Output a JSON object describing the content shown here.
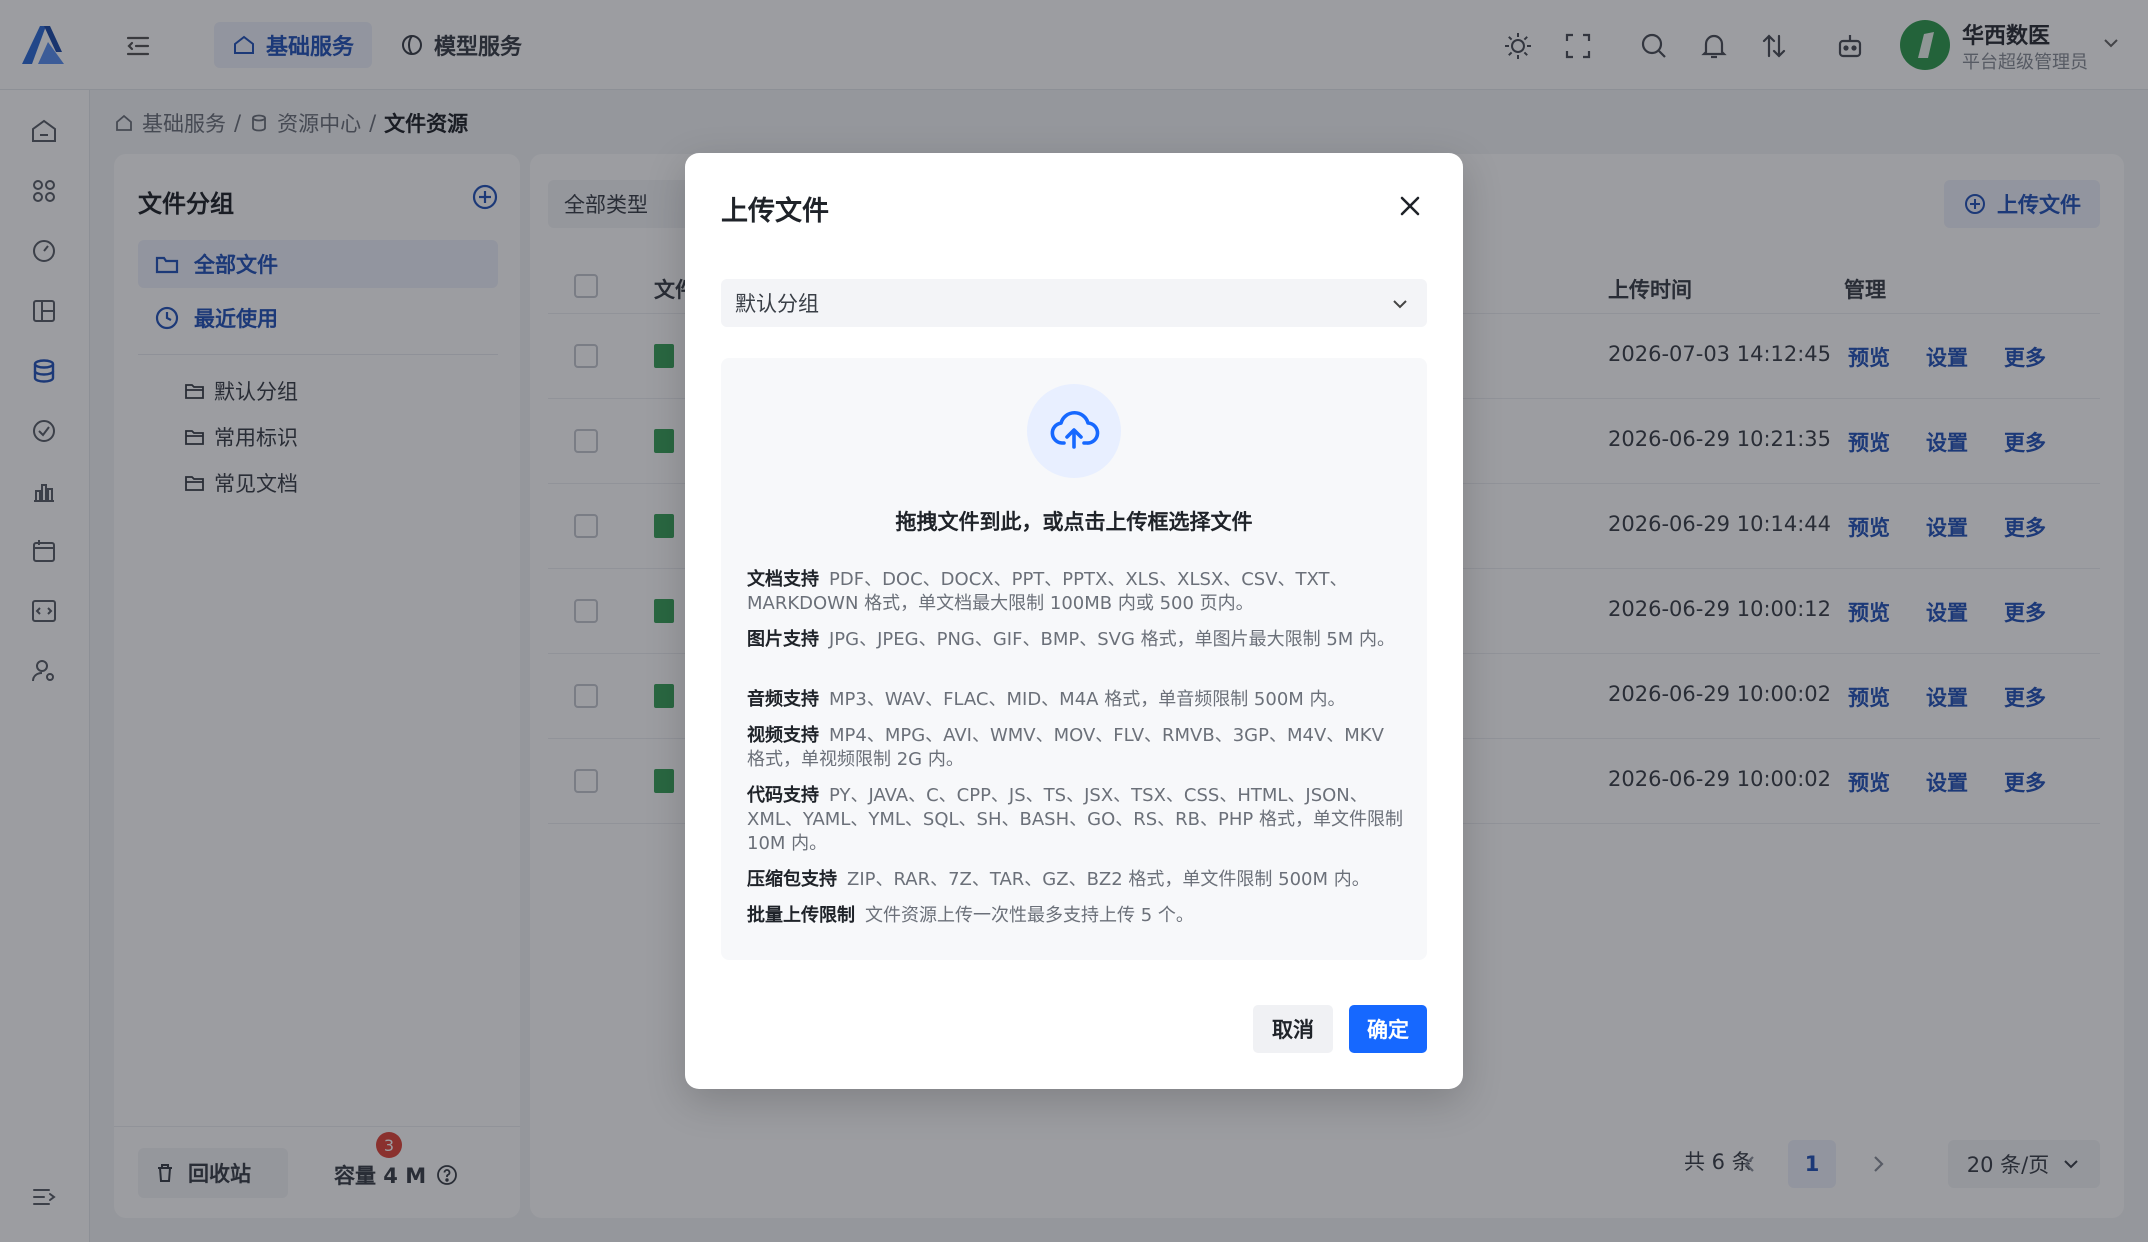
{
  "header": {
    "tabs": [
      {
        "label": "基础服务",
        "active": true
      },
      {
        "label": "模型服务",
        "active": false
      }
    ],
    "user": {
      "name": "华西数医",
      "role": "平台超级管理员"
    }
  },
  "breadcrumb": [
    "基础服务",
    "资源中心",
    "文件资源"
  ],
  "breadcrumb_sep": "/",
  "left_panel": {
    "title": "文件分组",
    "nav": [
      "全部文件",
      "最近使用"
    ],
    "folders": [
      "默认分组",
      "常用标识",
      "常见文档"
    ],
    "recycle_label": "回收站",
    "recycle_badge": "3",
    "capacity": "容量 4 M"
  },
  "toolbar": {
    "type_filter": "全部类型",
    "upload_label": "上传文件"
  },
  "table": {
    "headers": {
      "name": "文件",
      "time": "上传时间",
      "manage": "管理"
    },
    "rows": [
      {
        "time": "2026-07-03 14:12:45"
      },
      {
        "time": "2026-06-29 10:21:35"
      },
      {
        "time": "2026-06-29 10:14:44"
      },
      {
        "time": "2026-06-29 10:00:12"
      },
      {
        "time": "2026-06-29 10:00:02"
      },
      {
        "time": "2026-06-29 10:00:02"
      }
    ],
    "actions": [
      "预览",
      "设置",
      "更多"
    ]
  },
  "pagination": {
    "total": "共 6 条",
    "page": "1",
    "page_size": "20 条/页"
  },
  "modal": {
    "title": "上传文件",
    "group_value": "默认分组",
    "hint": "拖拽文件到此，或点击上传框选择文件",
    "specs": [
      {
        "label": "文档支持",
        "text": "PDF、DOC、DOCX、PPT、PPTX、XLS、XLSX、CSV、TXT、MARKDOWN 格式，单文档最大限制 100MB 内或 500 页内。"
      },
      {
        "label": "图片支持",
        "text": "JPG、JPEG、PNG、GIF、BMP、SVG 格式，单图片最大限制 5M 内。"
      },
      {
        "label": "音频支持",
        "text": "MP3、WAV、FLAC、MID、M4A 格式，单音频限制 500M 内。"
      },
      {
        "label": "视频支持",
        "text": "MP4、MPG、AVI、WMV、MOV、FLV、RMVB、3GP、M4V、MKV 格式，单视频限制 2G 内。"
      },
      {
        "label": "代码支持",
        "text": "PY、JAVA、C、CPP、JS、TS、JSX、TSX、CSS、HTML、JSON、XML、YAML、YML、SQL、SH、BASH、GO、RS、RB、PHP 格式，单文件限制 10M 内。"
      },
      {
        "label": "压缩包支持",
        "text": "ZIP、RAR、7Z、TAR、GZ、BZ2 格式，单文件限制 500M 内。"
      },
      {
        "label": "批量上传限制",
        "text": "文件资源上传一次性最多支持上传 5 个。"
      }
    ],
    "cancel_label": "取消",
    "ok_label": "确定"
  },
  "colors": {
    "accent": "#2453b8",
    "primary_button": "#1668ff",
    "badge": "#e0453a"
  }
}
